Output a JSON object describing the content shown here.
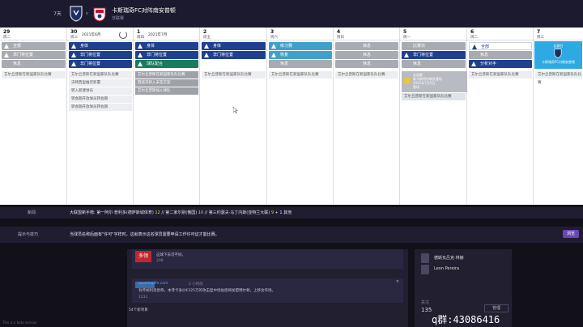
{
  "header": {
    "days_left": "7天",
    "title": "卡斯瑞奇FC对阵南安普顿",
    "subtitle": "非联赛",
    "vs": "v"
  },
  "days": [
    {
      "num": "29",
      "name": "周二",
      "date": ""
    },
    {
      "num": "30",
      "name": "周三",
      "date": "2021年6月"
    },
    {
      "num": "1",
      "name": "周四",
      "date": "2021年7月"
    },
    {
      "num": "2",
      "name": "周五",
      "date": ""
    },
    {
      "num": "3",
      "name": "周六",
      "date": ""
    },
    {
      "num": "4",
      "name": "周日",
      "date": ""
    },
    {
      "num": "5",
      "name": "周一",
      "date": ""
    },
    {
      "num": "6",
      "name": "周二",
      "date": ""
    },
    {
      "num": "7",
      "name": "周三",
      "date": ""
    }
  ],
  "sessions": {
    "d0": [
      "全部",
      "非门将位置",
      "休息"
    ],
    "d1": [
      "身体",
      "非门将位置",
      "非门将位置"
    ],
    "d2": [
      "身体",
      "非门将位置",
      "球队配合"
    ],
    "d3": [
      "身体",
      "非门将位置"
    ],
    "d4": [
      "练习赛",
      "恢复",
      "休息"
    ],
    "d5": [
      "休息",
      "休息",
      "休息"
    ],
    "d6": [
      "比赛日",
      "非门将位置",
      "休息"
    ],
    "d7": [
      "全部",
      "休息",
      "分析对手"
    ],
    "d8": [
      "比赛日",
      "卡斯瑞奇FC对南安普顿"
    ]
  },
  "notes": {
    "d0": [
      "艾尔丘普斯在新国家队队比赛"
    ],
    "d1": [
      "艾尔丘普斯在新国家队队比赛",
      "沃特西里推迟新署",
      "转入新建球员",
      "转会期开放球员转会期",
      "转会期开放球员转会期"
    ],
    "d2": [
      "艾尔丘普斯在新国家队队比赛",
      "西班牙新入未签方案",
      "艾尔丘普斯加入球队"
    ],
    "d3": [
      "艾尔丘普斯在新国家队队比赛"
    ],
    "d4": [
      "艾尔丘普斯在新国家队队比赛"
    ],
    "d5": [
      "艾尔丘普斯在新国家队队比赛"
    ],
    "d6": [
      "艾尔丘普斯在新国家队队比赛"
    ],
    "d7": [
      "艾尔丘普斯在新国家队队比赛"
    ],
    "d8": [
      "艾尔丘普斯在新国家队队比赛"
    ]
  },
  "match_card": {
    "line1": "友谊赛",
    "line2": "新卡斯特尔联队客场",
    "line3": "2021年7月5日",
    "line4": "客场"
  },
  "info": {
    "news_label": "新闻",
    "news_pre": "大联盟新手榜: 第一阿尔·普利多(德萨斯城体育)",
    "news_v1": "12",
    "news_mid1": " // 第二家尔别(俄国)",
    "news_v2": "10",
    "news_mid2": " // 第三约瑟夫·马丁内斯(亚特兰大联)",
    "news_tail": " + 1 其他",
    "news_v3": "9",
    "tips_label": "提示与技巧",
    "tips_text": "当球员名称后面有\"许可\"字样时，这就表示这名球员需要申请工作许可证才能比赛。",
    "review_btn": "浏览"
  },
  "feed": {
    "card1_logo": "多领",
    "card1_text": "这球下去可不妙。",
    "card1_likes": "208",
    "card2_source": "sportinglife.com",
    "card2_time": "2 小时前",
    "card2_text": "有传闻利消息称，本菲卡身价€325万的攻击型中场伯恩将加盟博尔顿，上移合作场。",
    "card2_likes": "1231",
    "more": "54个新项目"
  },
  "side": {
    "player1": "德斯瓦吕克·林赫",
    "player2": "Leon Pereira",
    "follow_label": "关注",
    "follow_count": "135",
    "follow_btn": "管理"
  },
  "beta": "This is a beta version",
  "watermark": "q群:43086416"
}
